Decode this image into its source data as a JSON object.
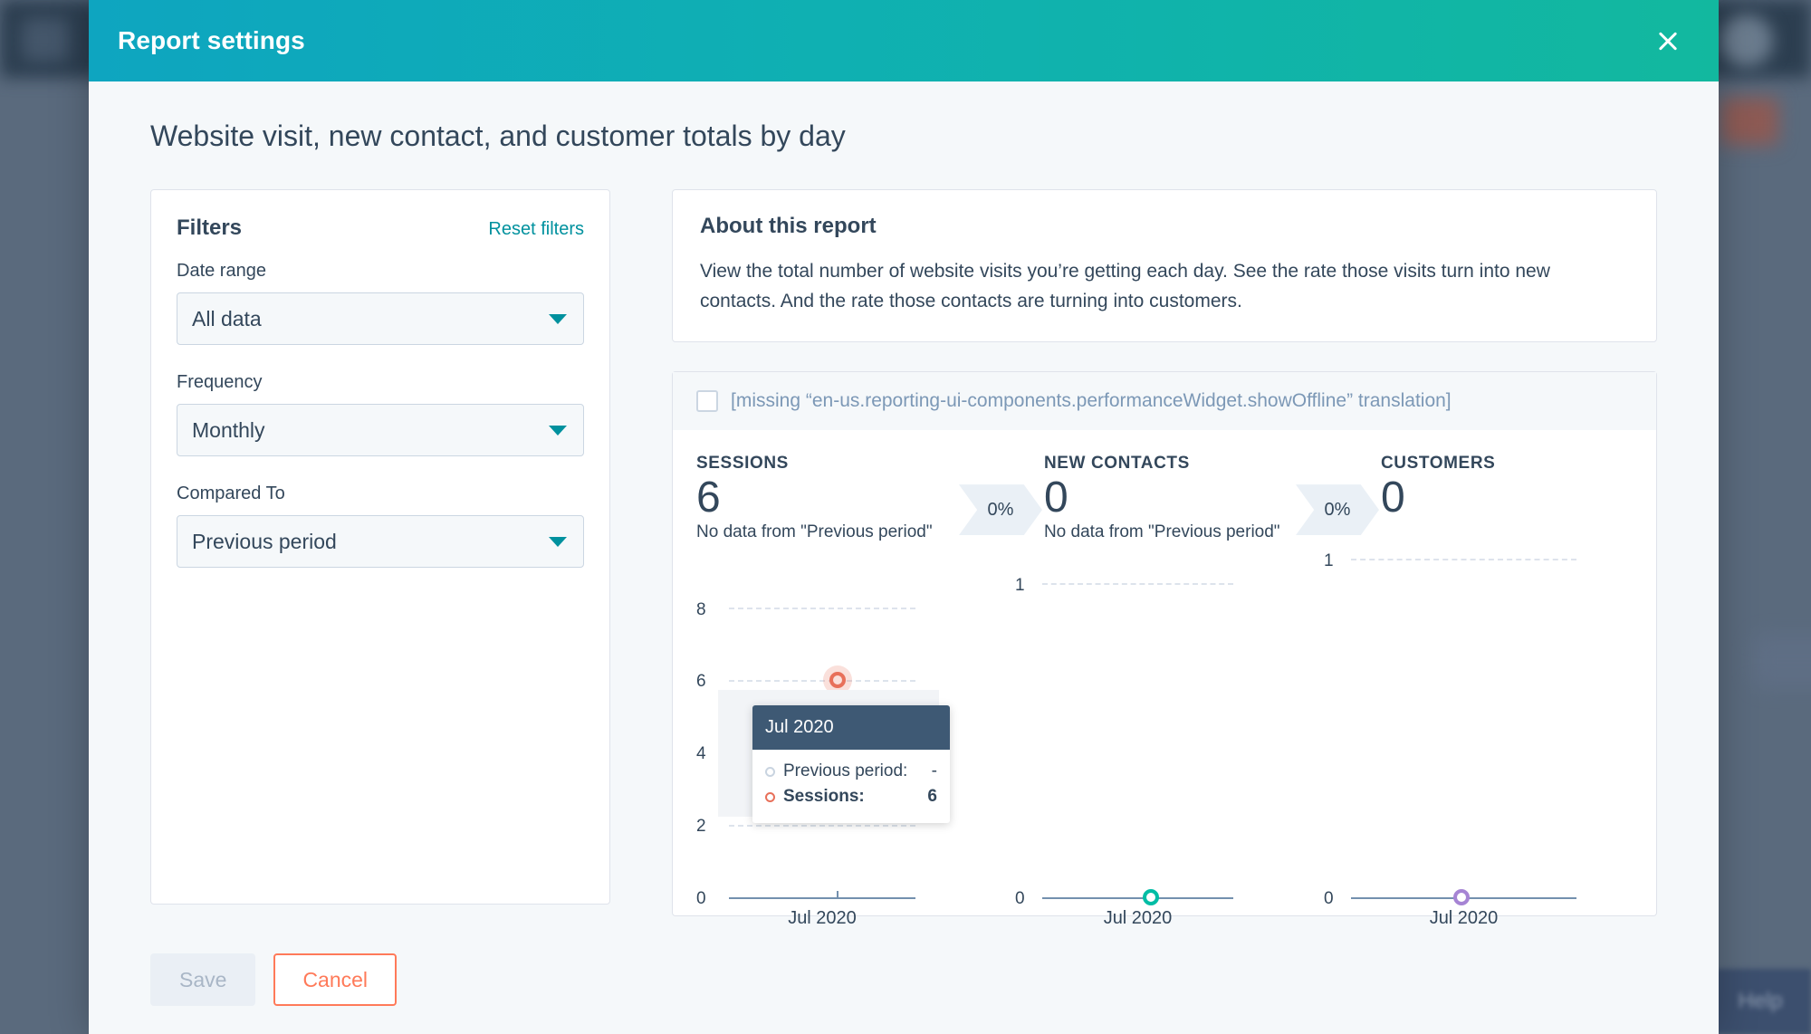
{
  "backdrop": {
    "help_label": "Help"
  },
  "modal": {
    "header_title": "Report settings",
    "close_icon": "close-icon",
    "report_title": "Website visit, new contact, and customer totals by day"
  },
  "filters": {
    "title": "Filters",
    "reset_label": "Reset filters",
    "fields": [
      {
        "label": "Date range",
        "value": "All data"
      },
      {
        "label": "Frequency",
        "value": "Monthly"
      },
      {
        "label": "Compared To",
        "value": "Previous period"
      }
    ]
  },
  "about": {
    "title": "About this report",
    "body": "View the total number of website visits you’re getting each day. See the rate those visits turn into new contacts. And the rate those contacts are turning into customers."
  },
  "performance": {
    "offline_checkbox_label": "[missing “en-us.reporting-ui-components.performanceWidget.showOffline” translation]",
    "offline_checked": false,
    "metrics": [
      {
        "label": "SESSIONS",
        "value": "6",
        "subtitle": "No data from \"Previous period\"",
        "delta": "0%",
        "color": "#e8705a"
      },
      {
        "label": "NEW CONTACTS",
        "value": "0",
        "subtitle": "No data from \"Previous period\"",
        "delta": "0%",
        "color": "#00bda5"
      },
      {
        "label": "CUSTOMERS",
        "value": "0",
        "subtitle": "",
        "delta": "",
        "color": "#a684d4"
      }
    ]
  },
  "tooltip": {
    "header": "Jul 2020",
    "rows": [
      {
        "name": "Previous period:",
        "value": "-",
        "bold": false,
        "dot": "grey"
      },
      {
        "name": "Sessions:",
        "value": "6",
        "bold": true,
        "dot": "orange"
      }
    ]
  },
  "footer": {
    "save_label": "Save",
    "cancel_label": "Cancel"
  },
  "chart_data": [
    {
      "type": "line",
      "title": "SESSIONS",
      "x": [
        "Jul 2020"
      ],
      "categories": [
        "Jul 2020"
      ],
      "values": [
        6
      ],
      "series": [
        {
          "name": "Sessions",
          "values": [
            6
          ],
          "color": "#e8705a"
        },
        {
          "name": "Previous period",
          "values": [
            null
          ],
          "color": "#c9d4e0"
        }
      ],
      "yticks": [
        "0",
        "2",
        "4",
        "6",
        "8"
      ],
      "ylim": [
        0,
        8
      ],
      "xlabel": "",
      "ylabel": "",
      "grid": true,
      "legend": "none"
    },
    {
      "type": "line",
      "title": "NEW CONTACTS",
      "x": [
        "Jul 2020"
      ],
      "categories": [
        "Jul 2020"
      ],
      "values": [
        0
      ],
      "series": [
        {
          "name": "New contacts",
          "values": [
            0
          ],
          "color": "#00bda5"
        }
      ],
      "yticks": [
        "0",
        "1"
      ],
      "ylim": [
        0,
        1
      ],
      "xlabel": "",
      "ylabel": "",
      "grid": true,
      "legend": "none"
    },
    {
      "type": "line",
      "title": "CUSTOMERS",
      "x": [
        "Jul 2020"
      ],
      "categories": [
        "Jul 2020"
      ],
      "values": [
        0
      ],
      "series": [
        {
          "name": "Customers",
          "values": [
            0
          ],
          "color": "#a684d4"
        }
      ],
      "yticks": [
        "0",
        "1"
      ],
      "ylim": [
        0,
        1
      ],
      "xlabel": "",
      "ylabel": "",
      "grid": true,
      "legend": "none"
    }
  ]
}
